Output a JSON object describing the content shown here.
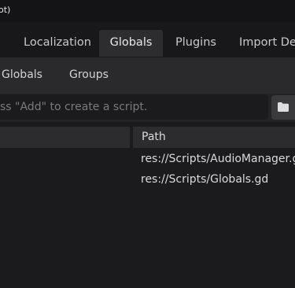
{
  "window": {
    "title": "ot)"
  },
  "tabs": [
    {
      "label": "Localization",
      "active": false
    },
    {
      "label": "Globals",
      "active": true
    },
    {
      "label": "Plugins",
      "active": false
    },
    {
      "label": "Import Def",
      "active": false
    }
  ],
  "subtabs": [
    {
      "label": "Globals"
    },
    {
      "label": "Groups"
    }
  ],
  "path_field": {
    "placeholder": "ss \"Add\" to create a script.",
    "value": ""
  },
  "folder_button": {
    "icon": "folder-icon"
  },
  "table": {
    "columns": [
      "",
      "Path"
    ],
    "rows": [
      {
        "path": "res://Scripts/AudioManager.gd"
      },
      {
        "path": "res://Scripts/Globals.gd"
      }
    ]
  },
  "colors": {
    "background": "#232325",
    "titlebar": "#141416",
    "active_tab": "#2d2d30",
    "input_bg": "#1b1b1d"
  }
}
